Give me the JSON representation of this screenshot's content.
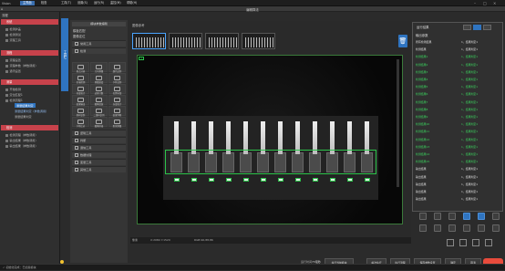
{
  "titlebar": {
    "app_name": "Vision",
    "tabs": [
      "主界面",
      "检查"
    ],
    "menu": [
      "工具(T)",
      "设置(S)",
      "运行(R)",
      "监控(M)",
      "帮助(H)"
    ],
    "window_title": "编辑算法"
  },
  "left_panel": {
    "header": "流程",
    "sections": [
      {
        "title": "系统",
        "items": [
          "检测护盖",
          "检测测试",
          "流程工具"
        ]
      },
      {
        "title": "流程",
        "items": [
          "流程设置",
          "流程参数（参数调用）",
          "通讯设置"
        ]
      },
      {
        "title": "测量",
        "items": [
          "开始检测",
          "定位匹配1",
          "检测流程1"
        ],
        "subitems": [
          "测量结果判定",
          "测量结果判定（参数调用）",
          "测量结果判定"
        ]
      },
      {
        "title": "检测",
        "items": [
          "检测流程（参数调用）",
          "输出结果（参数调用）",
          "输出结果（参数调用）"
        ]
      }
    ]
  },
  "tool_panel": {
    "tab_label": "工具栏",
    "title": "模块参数编辑",
    "section1": "模板匹配",
    "section2": "图像定位",
    "group_all": "常用工具",
    "group_detect": "检测",
    "grid": [
      "斑点分析",
      "几何测量",
      "颜色识别",
      "区域检测",
      "测量宽度",
      "字符识别",
      "亮度统计",
      "边缘计数",
      "位置补偿",
      "结果输出",
      "图像滤波",
      "灰度统计",
      "条码识别",
      "二维码识别",
      "结果判断",
      "字符比对",
      "图像拼接",
      "距离测量"
    ],
    "list": [
      "逻辑工具",
      "判断",
      "通信工具",
      "数据处理",
      "变量工具",
      "其他工具"
    ]
  },
  "center": {
    "panel_title": "图像参考",
    "status_left": "像素",
    "status_coords": "X:2084 Y:1520",
    "status_value": "RGB:90,88,86"
  },
  "right_panel": {
    "header": "运行结果",
    "subheader": "输出参数",
    "rows": [
      {
        "label": "所有检测结果",
        "value": "1，结果判定1",
        "color": "white"
      },
      {
        "label": "检测结果",
        "value": "1，结果判定1",
        "color": "white"
      },
      {
        "label": "检测结果1",
        "value": "1，结果判定1",
        "color": "green"
      },
      {
        "label": "检测结果2",
        "value": "1，结果判定1",
        "color": "green"
      },
      {
        "label": "检测结果3",
        "value": "1，结果判定1",
        "color": "green"
      },
      {
        "label": "检测结果4",
        "value": "1，结果判定1",
        "color": "green"
      },
      {
        "label": "检测结果5",
        "value": "1，结果判定1",
        "color": "green"
      },
      {
        "label": "检测结果6",
        "value": "1，结果判定1",
        "color": "green"
      },
      {
        "label": "检测结果7",
        "value": "1，结果判定1",
        "color": "green"
      },
      {
        "label": "检测结果8",
        "value": "1，结果判定1",
        "color": "green"
      },
      {
        "label": "检测结果9",
        "value": "1，结果判定1",
        "color": "green"
      },
      {
        "label": "检测结果10",
        "value": "1，结果判定1",
        "color": "green"
      },
      {
        "label": "检测结果11",
        "value": "1，结果判定1",
        "color": "green"
      },
      {
        "label": "检测结果12",
        "value": "1，结果判定1",
        "color": "green"
      },
      {
        "label": "检测结果13",
        "value": "1，结果判定1",
        "color": "green"
      },
      {
        "label": "检测结果14",
        "value": "1，结果判定1",
        "color": "green"
      },
      {
        "label": "检测结果15",
        "value": "1，结果判定1",
        "color": "green"
      },
      {
        "label": "输出结果",
        "value": "1，结果判定1",
        "color": "white"
      },
      {
        "label": "输出结果",
        "value": "1，结果判定1",
        "color": "white"
      },
      {
        "label": "输出结果",
        "value": "1，结果判定1",
        "color": "white"
      },
      {
        "label": "输出结果",
        "value": "1，结果判定1",
        "color": "white"
      },
      {
        "label": "输出结果",
        "value": "1，结果判定1",
        "color": "white"
      }
    ]
  },
  "bottom": {
    "status": "✓ 初始化完成：已加载模块",
    "run_time_label": "运行时间",
    "run_time": "73毫秒",
    "buttons": [
      "执行当前模块",
      "单次执行",
      "执行流程",
      "保存参数设置",
      "确定",
      "取消"
    ]
  },
  "colors": {
    "accent": "#2f74c0",
    "section": "#c7424b",
    "ok": "#3bd25d"
  }
}
